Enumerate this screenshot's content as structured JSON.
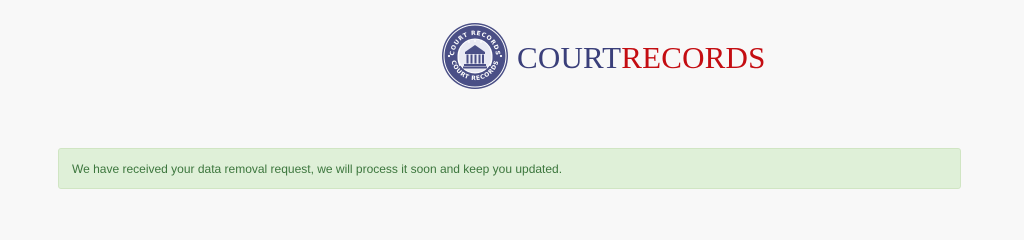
{
  "brand": {
    "name_part1": "COURT",
    "name_part2": "RECORDS",
    "seal_text": "COURT RECORDS",
    "colors": {
      "court": "#3a3f7a",
      "records": "#c40d12",
      "seal": "#4a4f86"
    }
  },
  "alert": {
    "type": "success",
    "message": "We have received your data removal request, we will process it soon and keep you updated.",
    "colors": {
      "background": "#dff0d8",
      "text": "#3c763d",
      "border": "#d0e5c3"
    }
  }
}
